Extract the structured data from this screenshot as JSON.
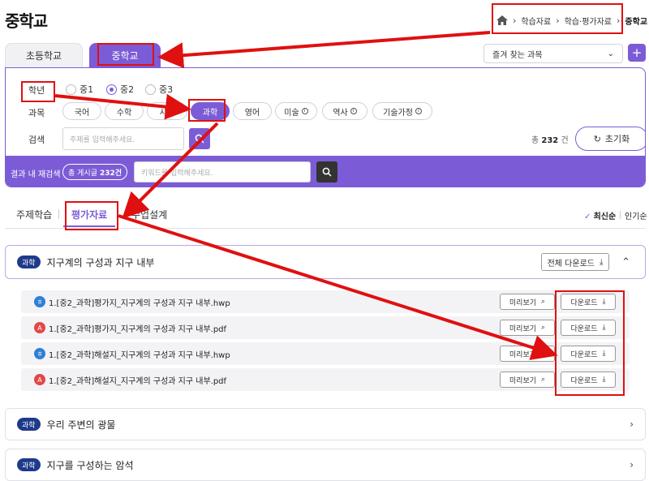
{
  "page_title": "중학교",
  "breadcrumb": {
    "items": [
      "학습자료",
      "학습·평가자료",
      "중학교"
    ]
  },
  "school_tabs": [
    "초등학교",
    "중학교"
  ],
  "favorite": {
    "label": "즐겨 찾는 과목",
    "add": "+"
  },
  "filters": {
    "grade_label": "학년",
    "grades": [
      "중1",
      "중2",
      "중3"
    ],
    "subject_label": "과목",
    "subjects": [
      "국어",
      "수학",
      "사회",
      "과학",
      "영어",
      "미술",
      "역사",
      "기술가정"
    ],
    "search_label": "검색",
    "search_placeholder": "주제를 입력해주세요.",
    "total_prefix": "총",
    "total_count": "232",
    "total_unit": "건",
    "reset_label": "초기화",
    "refine_label": "결과 내 재검색",
    "refine_count_prefix": "총 게시글",
    "refine_count": "232건",
    "refine_placeholder": "키워드를 입력해주세요."
  },
  "content_tabs": [
    "주제학습",
    "평가자료",
    "수업설계"
  ],
  "sort": {
    "latest": "최신순",
    "popular": "인기순"
  },
  "accordions": [
    {
      "badge": "과학",
      "title": "지구계의 구성과 지구 내부",
      "all_download": "전체 다운로드",
      "files": [
        {
          "type": "hwp",
          "name": "1.[중2_과학]평가지_지구계의 구성과 지구 내부.hwp"
        },
        {
          "type": "pdf",
          "name": "1.[중2_과학]평가지_지구계의 구성과 지구 내부.pdf"
        },
        {
          "type": "hwp",
          "name": "1.[중2_과학]해설지_지구계의 구성과 지구 내부.hwp"
        },
        {
          "type": "pdf",
          "name": "1.[중2_과학]해설지_지구계의 구성과 지구 내부.pdf"
        }
      ],
      "preview_label": "미리보기",
      "download_label": "다운로드"
    },
    {
      "badge": "과학",
      "title": "우리 주변의 광물"
    },
    {
      "badge": "과학",
      "title": "지구를 구성하는 암석"
    }
  ],
  "colors": {
    "accent": "#7c5cd6",
    "badge": "#1e3a8a",
    "annotation": "#e01010"
  }
}
